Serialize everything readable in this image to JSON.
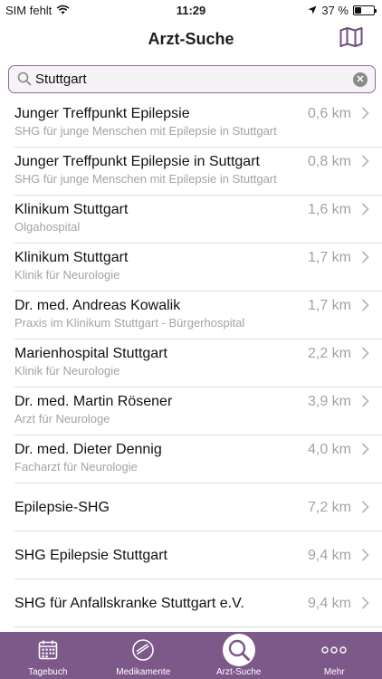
{
  "status": {
    "carrier": "SIM fehlt",
    "time": "11:29",
    "battery_text": "37 %",
    "battery_level": 0.37
  },
  "nav": {
    "title": "Arzt-Suche",
    "map_icon": "map-icon"
  },
  "search": {
    "value": "Stuttgart",
    "placeholder": ""
  },
  "results": [
    {
      "title": "Junger Treffpunkt Epilepsie",
      "subtitle": "SHG für junge Menschen mit Epilepsie in Stuttgart",
      "distance": "0,6 km"
    },
    {
      "title": "Junger Treffpunkt Epilepsie in Suttgart",
      "subtitle": "SHG für junge Menschen mit Epilepsie in Stuttgart",
      "distance": "0,8 km"
    },
    {
      "title": "Klinikum Stuttgart",
      "subtitle": "Olgahospital",
      "distance": "1,6 km"
    },
    {
      "title": "Klinikum Stuttgart",
      "subtitle": "Klinik für Neurologie",
      "distance": "1,7 km"
    },
    {
      "title": "Dr. med. Andreas Kowalik",
      "subtitle": "Praxis im Klinikum Stuttgart - Bürgerhospital",
      "distance": "1,7 km"
    },
    {
      "title": "Marienhospital Stuttgart",
      "subtitle": "Klinik für Neurologie",
      "distance": "2,2 km"
    },
    {
      "title": "Dr. med. Martin Rösener",
      "subtitle": "Arzt für Neurologe",
      "distance": "3,9 km"
    },
    {
      "title": "Dr. med. Dieter Dennig",
      "subtitle": "Facharzt für Neurologie",
      "distance": "4,0 km"
    },
    {
      "title": "Epilepsie-SHG",
      "subtitle": "",
      "distance": "7,2 km"
    },
    {
      "title": "SHG Epilepsie Stuttgart",
      "subtitle": "",
      "distance": "9,4 km"
    },
    {
      "title": "SHG für Anfallskranke Stuttgart e.V.",
      "subtitle": "",
      "distance": "9,4 km"
    }
  ],
  "tabs": [
    {
      "label": "Tagebuch",
      "icon": "calendar-icon",
      "active": false
    },
    {
      "label": "Medikamente",
      "icon": "pill-icon",
      "active": false
    },
    {
      "label": "Arzt-Suche",
      "icon": "search-icon",
      "active": true
    },
    {
      "label": "Mehr",
      "icon": "more-icon",
      "active": false
    }
  ],
  "colors": {
    "accent": "#7c5988",
    "search_border": "#8e6a96",
    "secondary_text": "#a3a3a3"
  }
}
